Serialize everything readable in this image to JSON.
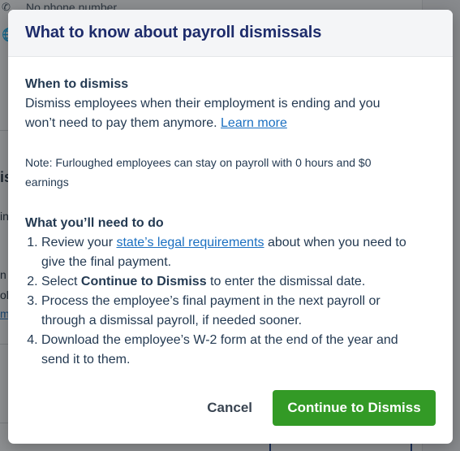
{
  "background": {
    "phone_text": "No phone number",
    "fragments": {
      "frag1": "is",
      "frag2": "in",
      "frag3": "n",
      "frag4": "ol",
      "frag5": "m"
    }
  },
  "modal": {
    "title": "What to know about payroll dismissals",
    "when": {
      "heading": "When to dismiss",
      "text": "Dismiss employees when their employment is ending and you won’t need to pay them anymore.",
      "link_label": "Learn more"
    },
    "note": "Note: Furloughed employees can stay on payroll with 0 hours and $0 earnings",
    "todo": {
      "heading": "What you’ll need to do",
      "step1_before": "Review your ",
      "step1_link": "state’s legal requirements",
      "step1_after": " about when you need to give the final payment.",
      "step2_before": "Select ",
      "step2_bold": "Continue to Dismiss",
      "step2_after": " to enter the dismissal date.",
      "step3": "Process the employee’s final payment in the next payroll or through a dismissal payroll, if needed sooner.",
      "step4": "Download the employee’s W-2 form at the end of the year and send it to them."
    },
    "buttons": {
      "cancel": "Cancel",
      "continue": "Continue to Dismiss"
    }
  },
  "colors": {
    "title": "#1e2c6b",
    "link": "#1a6fc1",
    "primary_button": "#339a26",
    "header_bg": "#f4f5f7"
  }
}
